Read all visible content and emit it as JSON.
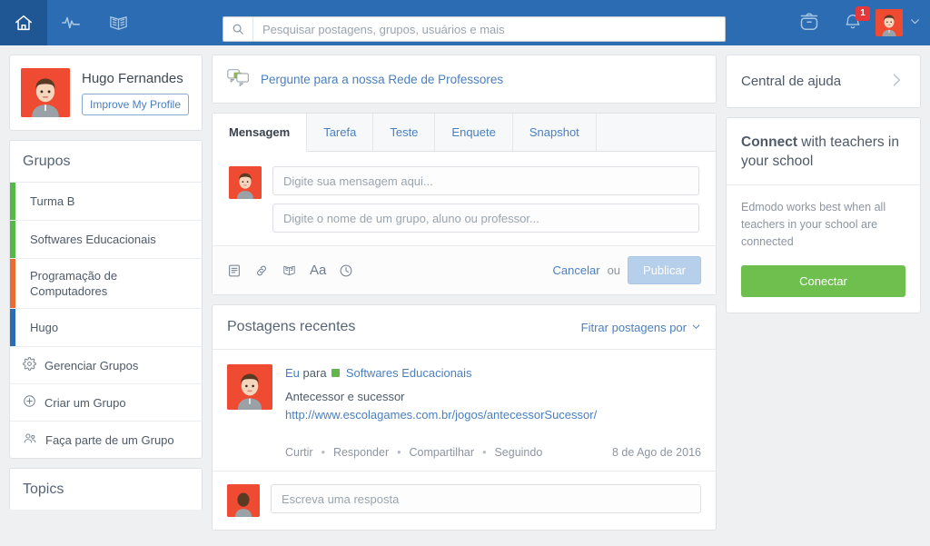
{
  "navbar": {
    "brand_color": "#2b6cb3",
    "active_color": "#1f5795",
    "items": [
      {
        "name": "home-icon",
        "label": "Início",
        "active": true
      },
      {
        "name": "activity-icon",
        "label": "Progresso",
        "active": false
      },
      {
        "name": "library-icon",
        "label": "Biblioteca",
        "active": false
      }
    ],
    "search": {
      "placeholder": "Pesquisar postagens, grupos, usuários e mais",
      "value": ""
    },
    "backpack_label": "Mochila",
    "notifications_label": "Notificações",
    "notifications_count": "1",
    "notifications_badge_color": "#e8373b",
    "avatar_label": "Hugo Fernandes"
  },
  "profile": {
    "name": "Hugo Fernandes",
    "improve_label": "Improve My Profile",
    "avatar_bg": "#ef4b32"
  },
  "groups": {
    "title": "Grupos",
    "items": [
      {
        "label": "Turma B",
        "color": "#55b947"
      },
      {
        "label": "Softwares Educacionais",
        "color": "#55b947"
      },
      {
        "label": "Programação de Computadores",
        "color": "#ec6b33"
      },
      {
        "label": "Hugo",
        "color": "#2b6cb3"
      }
    ],
    "actions": [
      {
        "label": "Gerenciar Grupos",
        "icon": "gear-icon"
      },
      {
        "label": "Criar um Grupo",
        "icon": "plus-circle-icon"
      },
      {
        "label": "Faça parte de um Grupo",
        "icon": "people-icon"
      }
    ]
  },
  "topics": {
    "title": "Topics"
  },
  "ask": {
    "label": "Pergunte para a nossa Rede de Professores",
    "icon": "chat-bubbles-icon"
  },
  "composer": {
    "tabs": [
      {
        "label": "Mensagem",
        "active": true
      },
      {
        "label": "Tarefa",
        "active": false
      },
      {
        "label": "Teste",
        "active": false
      },
      {
        "label": "Enquete",
        "active": false
      },
      {
        "label": "Snapshot",
        "active": false
      }
    ],
    "message_placeholder": "Digite sua mensagem aqui...",
    "message_value": "",
    "recipient_placeholder": "Digite o nome de um grupo, aluno ou professor...",
    "recipient_value": "",
    "tools": [
      {
        "icon": "file-icon",
        "label": "Anexar arquivo"
      },
      {
        "icon": "link-icon",
        "label": "Anexar link"
      },
      {
        "icon": "library-icon",
        "label": "Biblioteca"
      },
      {
        "icon": "text-format-icon",
        "label": "Aa"
      },
      {
        "icon": "clock-icon",
        "label": "Agendar"
      }
    ],
    "aa_label": "Aa",
    "cancel_label": "Cancelar",
    "or_label": "ou",
    "publish_label": "Publicar",
    "publish_disabled_color": "#b6cfeb"
  },
  "posts": {
    "title": "Postagens recentes",
    "filter_label": "Fitrar postagens por",
    "items": [
      {
        "author": "Eu",
        "to_label": "para",
        "group": "Softwares Educacionais",
        "group_color": "#62b64d",
        "text": "Antecessor e sucessor",
        "url": "http://www.escolagames.com.br/jogos/antecessorSucessor/",
        "actions": [
          "Curtir",
          "Responder",
          "Compartilhar",
          "Seguindo"
        ],
        "date": "8 de Ago de 2016",
        "reply_placeholder": "Escreva uma resposta"
      }
    ]
  },
  "help": {
    "title": "Central de ajuda",
    "chevron": "chevron-right-icon"
  },
  "connect": {
    "title_bold": "Connect",
    "title_rest": " with teachers in your school",
    "body": "Edmodo works best when all teachers in your school are connected",
    "button_label": "Conectar",
    "button_color": "#6fbf4f"
  }
}
